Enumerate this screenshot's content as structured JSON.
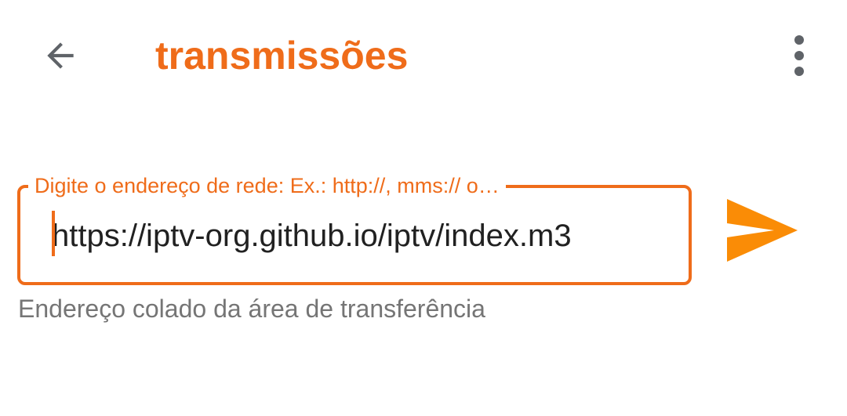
{
  "colors": {
    "accent": "#ef6c1a",
    "send": "#fa8c06",
    "icon": "#5f6368",
    "helper": "#757575",
    "text": "#212121"
  },
  "toolbar": {
    "back_icon": "arrow-back-icon",
    "title": "transmissões",
    "more_icon": "more-vert-icon"
  },
  "url_field": {
    "label": "Digite o endereço de rede: Ex.: http://, mms:// o…",
    "value": "https://iptv-org.github.io/iptv/index.m3",
    "helper": "Endereço colado da área de transferência"
  },
  "send": {
    "icon": "send-icon"
  }
}
